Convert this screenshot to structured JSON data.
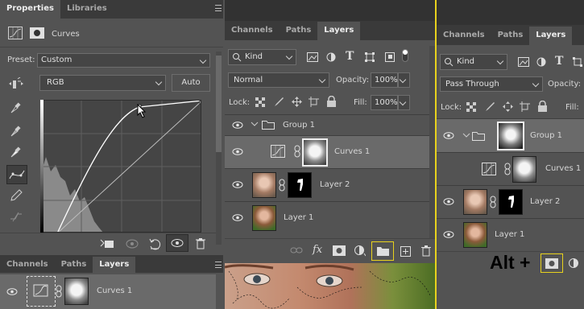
{
  "properties": {
    "tabs": [
      "Properties",
      "Libraries"
    ],
    "title": "Curves",
    "preset_label": "Preset:",
    "preset_value": "Custom",
    "channel_value": "RGB",
    "auto_label": "Auto"
  },
  "bottom_left": {
    "tabs": [
      "Channels",
      "Paths",
      "Layers"
    ],
    "layer_name": "Curves 1"
  },
  "middle": {
    "tabs": [
      "Channels",
      "Paths",
      "Layers"
    ],
    "filter_kind": "Kind",
    "blend_mode": "Normal",
    "opacity_label": "Opacity:",
    "opacity_value": "100%",
    "lock_label": "Lock:",
    "fill_label": "Fill:",
    "fill_value": "100%",
    "layers": [
      "Group 1",
      "Curves 1",
      "Layer 2",
      "Layer 1"
    ]
  },
  "right": {
    "tabs": [
      "Channels",
      "Paths",
      "Layers"
    ],
    "filter_kind": "Kind",
    "blend_mode": "Pass Through",
    "opacity_label": "Opacity:",
    "lock_label": "Lock:",
    "fill_label": "Fill:",
    "layers": [
      "Group 1",
      "Curves 1",
      "Layer 2",
      "Layer 1"
    ],
    "shortcut_text": "Alt +"
  },
  "colors": {
    "highlight": "#e8d21d",
    "panel": "#535353",
    "dark": "#3a3a3a"
  },
  "icons": [
    "eye-icon",
    "folder-icon",
    "link-icon",
    "trash-icon",
    "mask-icon",
    "adjustment-icon",
    "new-layer-icon",
    "fx-icon"
  ]
}
